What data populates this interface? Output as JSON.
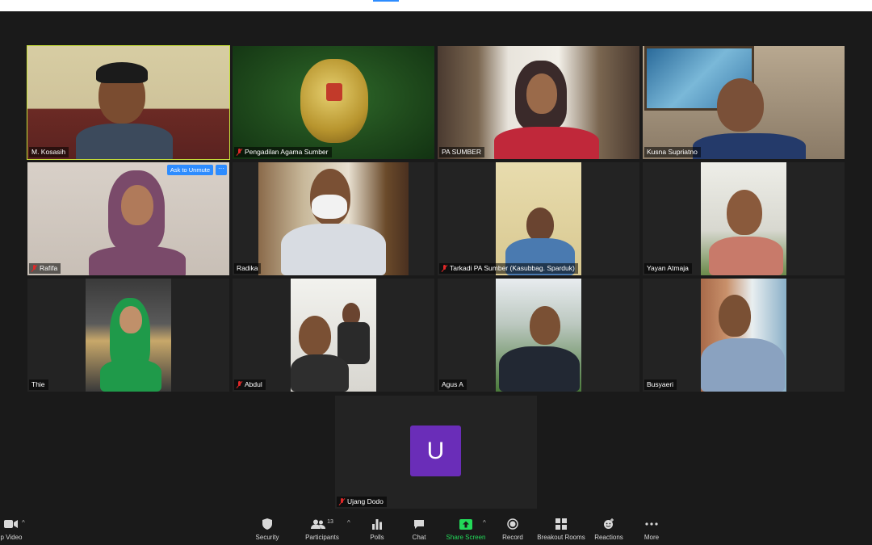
{
  "meeting": {
    "participants": [
      {
        "name": "M. Kosasih",
        "muted": false,
        "active_speaker": true
      },
      {
        "name": "Pengadilan Agama Sumber",
        "muted": true
      },
      {
        "name": "PA SUMBER",
        "muted": false
      },
      {
        "name": "Kusna Supriatno",
        "muted": false
      },
      {
        "name": "Rafifa",
        "muted": true,
        "ask_to_unmute": "Ask to Unmute",
        "more": "···"
      },
      {
        "name": "Radika",
        "muted": false
      },
      {
        "name": "Tarkadi PA Sumber (Kasubbag. Sparduk)",
        "muted": true
      },
      {
        "name": "Yayan Atmaja",
        "muted": false
      },
      {
        "name": "Thie",
        "muted": false
      },
      {
        "name": "Abdul",
        "muted": true
      },
      {
        "name": "Agus A",
        "muted": false
      },
      {
        "name": "Busyaeri",
        "muted": false
      },
      {
        "name": "Ujang Dodo",
        "muted": true,
        "avatar_letter": "U"
      }
    ]
  },
  "toolbar": {
    "start_video": "p Video",
    "security": "Security",
    "participants": "Participants",
    "participants_count": "13",
    "polls": "Polls",
    "chat": "Chat",
    "share_screen": "Share Screen",
    "record": "Record",
    "breakout_rooms": "Breakout Rooms",
    "reactions": "Reactions",
    "more": "More"
  },
  "colors": {
    "active_speaker_border": "#c8e03a",
    "share_screen_green": "#23d959",
    "avatar_purple": "#6a2db8",
    "muted_red": "#e02828",
    "zoom_blue": "#2d8cff"
  }
}
